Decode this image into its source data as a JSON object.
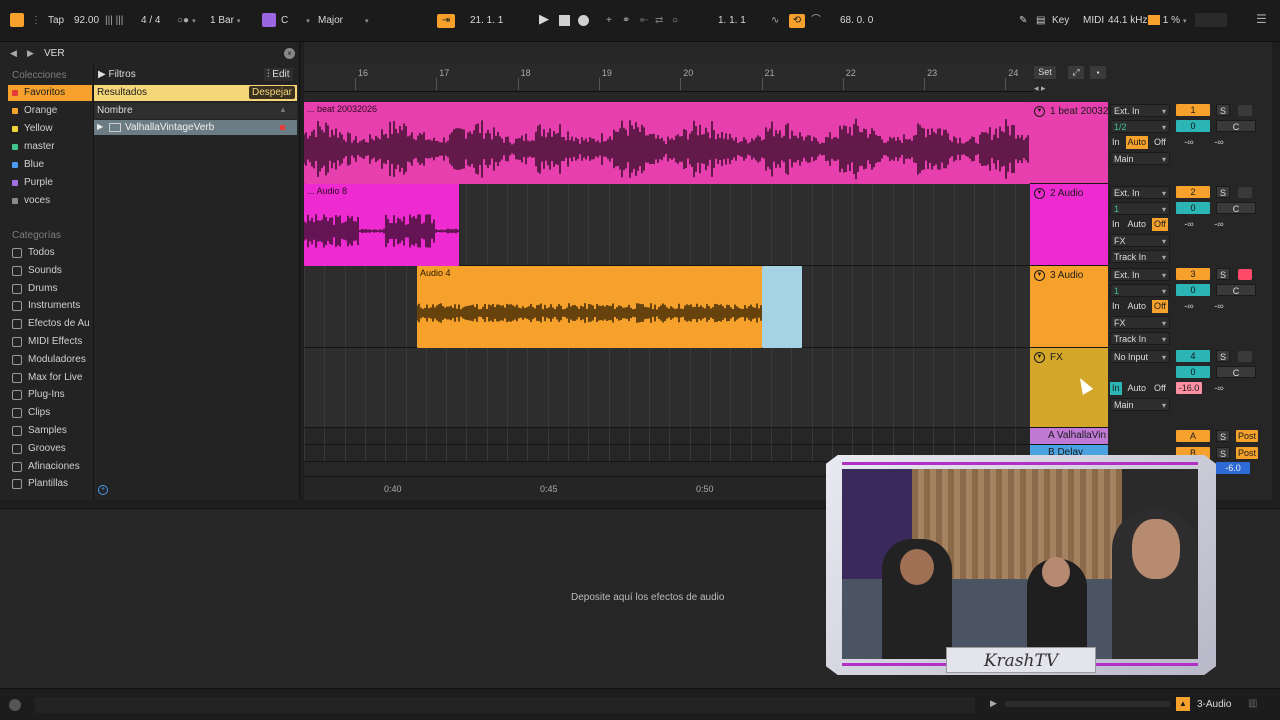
{
  "toolbar": {
    "tap": "Tap",
    "tempo": "92.00",
    "time_sig": "4 / 4",
    "quantize": "1 Bar",
    "key": "C",
    "scale": "Major",
    "arr_position": "21.  1.  1",
    "loop_start": "1.  1.  1",
    "loop_length": "68.  0.  0",
    "key_label": "Key",
    "midi_label": "MIDI",
    "sample_rate": "44.1 kHz",
    "cpu": "1 %"
  },
  "browser": {
    "search_value": "VER",
    "collections_header": "Colecciones",
    "collections": [
      {
        "label": "Favoritos",
        "color": "#e63b3b"
      },
      {
        "label": "Orange",
        "color": "#f5a12c"
      },
      {
        "label": "Yellow",
        "color": "#f0d43a"
      },
      {
        "label": "master",
        "color": "#3fc48b"
      },
      {
        "label": "Blue",
        "color": "#4a9bf0"
      },
      {
        "label": "Purple",
        "color": "#a070e8"
      },
      {
        "label": "voces",
        "color": "#8a8a8a"
      }
    ],
    "categories_header": "Categorías",
    "categories": [
      {
        "label": "Todos",
        "icon": "bars-icon"
      },
      {
        "label": "Sounds",
        "icon": "waves-icon"
      },
      {
        "label": "Drums",
        "icon": "drum-icon"
      },
      {
        "label": "Instruments",
        "icon": "clock-icon"
      },
      {
        "label": "Efectos de Au",
        "icon": "fx-icon"
      },
      {
        "label": "MIDI Effects",
        "icon": "midi-icon"
      },
      {
        "label": "Moduladores",
        "icon": "mod-icon"
      },
      {
        "label": "Max for Live",
        "icon": "max-icon"
      },
      {
        "label": "Plug-Ins",
        "icon": "plug-icon"
      },
      {
        "label": "Clips",
        "icon": "play-box-icon"
      },
      {
        "label": "Samples",
        "icon": "wave-box-icon"
      },
      {
        "label": "Grooves",
        "icon": "groove-icon"
      },
      {
        "label": "Afinaciones",
        "icon": "tuning-icon"
      },
      {
        "label": "Plantillas",
        "icon": "template-icon"
      }
    ],
    "filters_label": "Filtros",
    "edit_label": "Edit",
    "results_label": "Resultados",
    "clear_label": "Despejar",
    "name_header": "Nombre",
    "result_item": "ValhallaVintageVerb"
  },
  "arrangement": {
    "bars": [
      "16",
      "17",
      "18",
      "19",
      "20",
      "21",
      "22",
      "23",
      "24"
    ],
    "set_label": "Set",
    "time_labels": [
      "0:40",
      "0:45",
      "0:50"
    ],
    "colors": {
      "pink": "#e83fae",
      "magenta": "#ee2bd0",
      "orange": "#f5a12c",
      "gold": "#d4a62a",
      "lightblue": "#a6d3e4"
    }
  },
  "tracks": [
    {
      "name": "1 beat 20032",
      "clip": "... beat 20032026",
      "input": "Ext. In",
      "channel": "1/2",
      "output": "Main",
      "number": "1",
      "volume": "0",
      "pan": "C",
      "meter_l": "-∞",
      "meter_r": "-∞",
      "monitor": [
        "In",
        "Auto",
        "Off"
      ]
    },
    {
      "name": "2 Audio",
      "clip": "... Audio 8",
      "input": "Ext. In",
      "channel": "1",
      "output": "FX",
      "output2": "Track In",
      "number": "2",
      "volume": "0",
      "pan": "C",
      "meter_l": "-∞",
      "meter_r": "-∞",
      "monitor": [
        "In",
        "Auto",
        "Off"
      ]
    },
    {
      "name": "3 Audio",
      "clip": "Audio 4",
      "input": "Ext. In",
      "channel": "1",
      "output": "FX",
      "output2": "Track In",
      "number": "3",
      "volume": "0",
      "pan": "C",
      "meter_l": "-∞",
      "meter_r": "-∞",
      "monitor": [
        "In",
        "Auto",
        "Off"
      ]
    },
    {
      "name": "FX",
      "input": "No Input",
      "output": "Main",
      "number": "4",
      "volume": "0",
      "pan": "C",
      "meter_l": "-16.0",
      "meter_r": "-∞",
      "monitor": [
        "In",
        "Auto",
        "Off"
      ]
    }
  ],
  "returns": [
    {
      "name": "A ValhallaVin",
      "letter": "A",
      "post": "Post",
      "solo": "S"
    },
    {
      "name": "B Delay",
      "letter": "B",
      "post": "Post",
      "solo": "S",
      "volume": "-6.0"
    }
  ],
  "solo_label": "S",
  "device_drop_text": "Deposite aquí los efectos de audio",
  "status": {
    "selected_track": "3-Audio"
  },
  "webcam": {
    "overlay_text": "KrashTV"
  }
}
